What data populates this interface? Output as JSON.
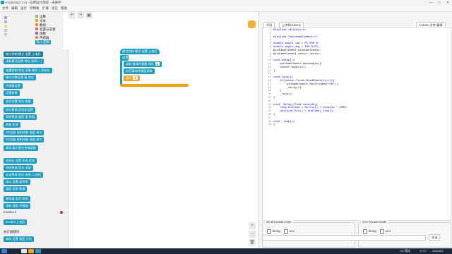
{
  "window": {
    "title": "Invobots(3.7.4) - 应用设计测试 - 未保存",
    "minimize": "—",
    "maximize": "□",
    "close": "✕"
  },
  "menu": [
    "文件",
    "编辑",
    "运行",
    "控制板",
    "扩展",
    "语言",
    "帮助"
  ],
  "categories_left": [
    "",
    "",
    "",
    "",
    "",
    "",
    ""
  ],
  "categories_right": [
    "运算",
    "文本",
    "数组",
    "变量与常量",
    "函数",
    "传感器",
    "私人定制"
  ],
  "palette": {
    "blocks": [
      "磁力控制 模式 设置 上电后",
      "读取模式设置 地址 选择(一)",
      "电量控制 地址 读取 模式 1 初始化",
      "循环次数设置 值 地址",
      "传感器设置",
      "设置参数",
      "语言设置 地址 数据",
      "执行数据 初始化设置",
      "获取数据 速度 值 数据",
      "数据 检测",
      "SG设备 电机控制 速度 调节",
      "SG设备 电机控制 速度 调节",
      "通讯 磁力感应参数读取",
      "初始化 设置 状态 距离",
      "接收数据 地址 读取",
      "发送数据 地址 选择 二进制",
      "串口 设置 波特率",
      "温度 读取 数据",
      "蜂鸣器 发声 频率",
      "读取 速度 传感器",
      "发射 延迟 设置 一个 值",
      "读取 指定 地址的数据 值"
    ],
    "section_label": "Invobot ▾",
    "section_block": "Invobot 上电后",
    "section_label2": "执行器模块",
    "section_block2": "电机 设置 速度 方向"
  },
  "workspace": {
    "hat_block": "磁力控制 模式 设置 上电后",
    "setup_label": "设置",
    "row1": "读取 磁场传感器 地址",
    "row2": "执行磁场传感器读取",
    "loop_label": "循环",
    "slot_a": "1",
    "slot_b": "1"
  },
  "codepanel": {
    "tab_code": "代码",
    "tab_upload": "上传到Arduino",
    "tab_right": "Arduino 文件 编辑",
    "lines": [
      "#include <Arduino.h>",
      "",
      "#include \"WindumeElement.h\"",
      "",
      "double angle_rad = PI/180.0;",
      "double angle_deg = 180.0/PI;",
      "WindumeElement windumelement;",
      "WindumeElement_sensor sensor;",
      "",
      "void setup(){",
      "    windumelement.mainbegin();",
      "    sensor.begin(2);",
      "}",
      "",
      "void loop(){",
      "    if(sensor.Touch_ReadState(1)==1){",
      "        windumelement.Motor(name(\"ON\"));",
      "        _delay(1);",
      "    }",
      "    _loop();",
      "}",
      "",
      "void _delay(float seconds){",
      "    long endTime = millis() + seconds * 1000;",
      "    while(millis() < endTime)_loop();",
      "}",
      "",
      "void _loop(){",
      "}"
    ],
    "send_group": "send encode mode",
    "recv_group": "recv encode mode",
    "opt_binary": "binary",
    "opt_text": "text",
    "send_btn": "发送",
    "clear_btn": "Clear"
  },
  "taskbar": {
    "time": "17:07",
    "date": "2020/5/6",
    "ime": "CH 简体"
  },
  "colors": {
    "block_blue": "#1c9bbf",
    "block_orange": "#f0a21a",
    "taskbar": "#1b2a3a",
    "palette_bg": "#f0f0f0"
  }
}
